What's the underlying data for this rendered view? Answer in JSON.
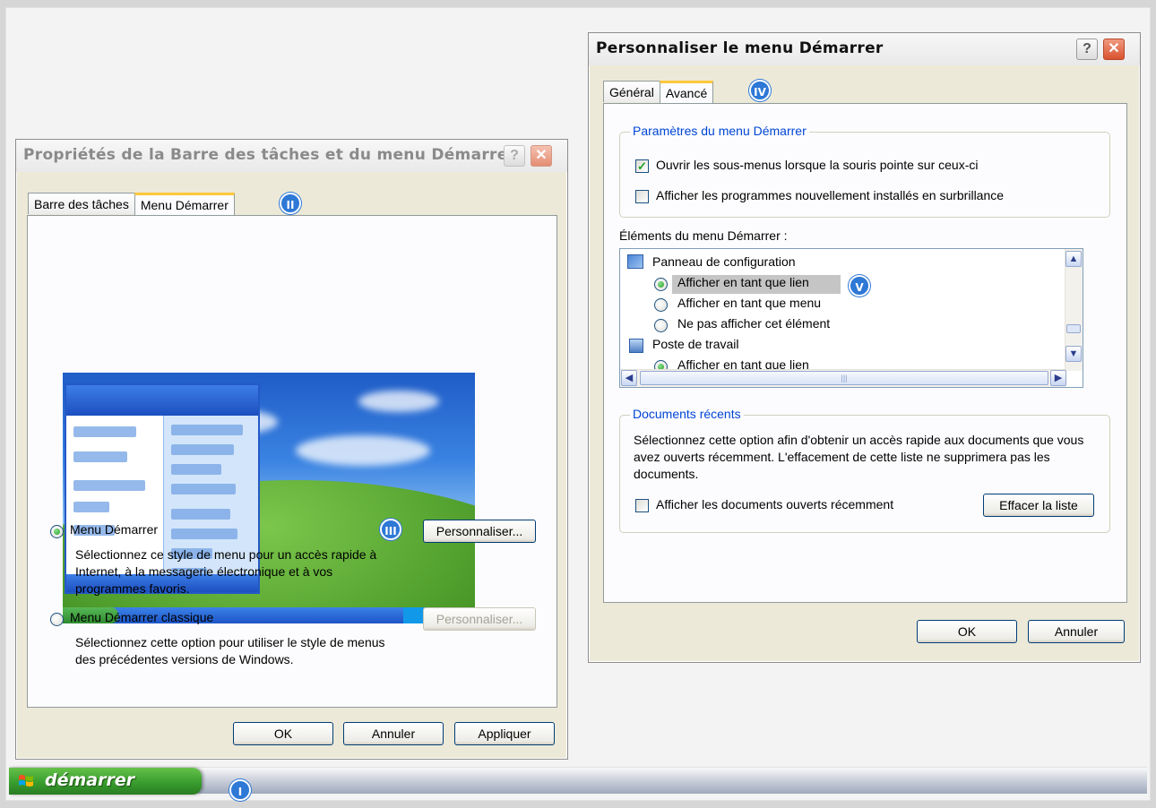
{
  "taskbar": {
    "start_label": "démarrer",
    "start_badge": "I"
  },
  "taskbar_props_window": {
    "title": "Propriétés de la Barre des tâches et du menu Démarrer",
    "help_glyph": "?",
    "close_glyph": "✕",
    "tabs": [
      "Barre des tâches",
      "Menu Démarrer"
    ],
    "tab_badge": "II",
    "preview_icons": [
      "start-menu-preview-icon"
    ],
    "option_start_menu": {
      "label": "Menu Démarrer",
      "description": "Sélectionnez ce style de menu pour un accès rapide à Internet, à la messagerie électronique et à vos programmes favoris.",
      "customize_label": "Personnaliser...",
      "badge": "III"
    },
    "option_classic": {
      "label": "Menu Démarrer classique",
      "description": "Sélectionnez cette option pour utiliser le style de menus des précédentes versions de Windows.",
      "customize_label": "Personnaliser..."
    },
    "buttons": {
      "ok": "OK",
      "cancel": "Annuler",
      "apply": "Appliquer"
    }
  },
  "customize_window": {
    "title": "Personnaliser le menu Démarrer",
    "help_glyph": "?",
    "close_glyph": "✕",
    "tabs": [
      "Général",
      "Avancé"
    ],
    "tab_badge": "IV",
    "settings_group": {
      "legend": "Paramètres du menu Démarrer",
      "open_submenus": "Ouvrir les sous-menus lorsque la souris pointe sur ceux-ci",
      "highlight_new": "Afficher les programmes nouvellement installés en surbrillance",
      "open_submenus_checked": true,
      "highlight_new_checked": false
    },
    "items_label": "Éléments du menu Démarrer :",
    "items": {
      "control_panel": "Panneau de configuration",
      "show_as_link": "Afficher en tant que lien",
      "show_as_menu": "Afficher en tant que menu",
      "dont_show": "Ne pas afficher cet élément",
      "my_computer": "Poste de travail",
      "show_as_link_2": "Afficher en tant que lien",
      "selected_badge": "V"
    },
    "recent_group": {
      "legend": "Documents récents",
      "description": "Sélectionnez cette option afin d'obtenir un accès rapide aux documents que vous avez ouverts récemment. L'effacement de cette liste ne supprimera pas les documents.",
      "show_recent": "Afficher les documents ouverts récemment",
      "clear_label": "Effacer la liste"
    },
    "buttons": {
      "ok": "OK",
      "cancel": "Annuler"
    }
  }
}
